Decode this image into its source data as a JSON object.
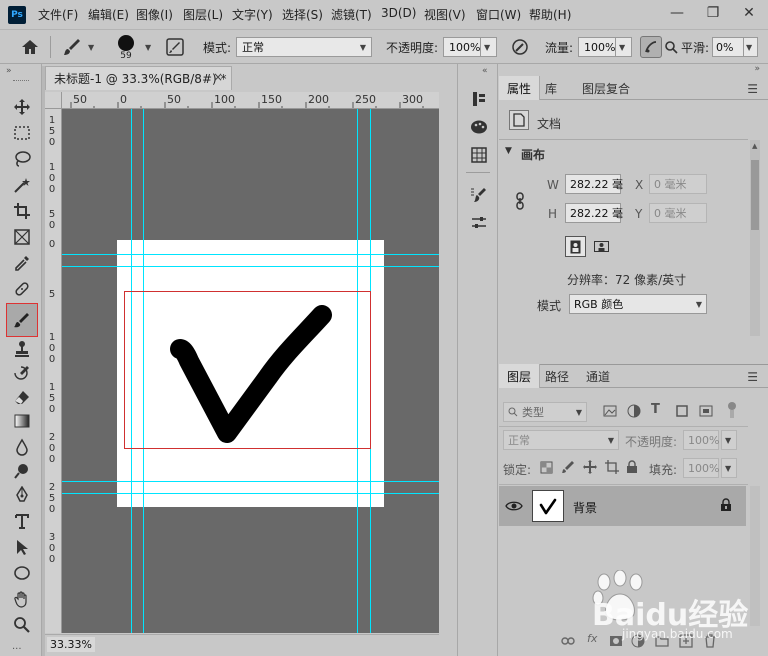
{
  "app": {
    "logo_text": "Ps"
  },
  "menu": [
    "文件(F)",
    "编辑(E)",
    "图像(I)",
    "图层(L)",
    "文字(Y)",
    "选择(S)",
    "滤镜(T)",
    "3D(D)",
    "视图(V)",
    "窗口(W)",
    "帮助(H)"
  ],
  "window_controls": {
    "minimize": "—",
    "maximize": "❐",
    "close": "✕"
  },
  "options_bar": {
    "brush_size": "59",
    "mode_label": "模式:",
    "mode_value": "正常",
    "opacity_label": "不透明度:",
    "opacity_value": "100%",
    "flow_label": "流量:",
    "flow_value": "100%",
    "smooth_label": "平滑:",
    "smooth_value": "0%"
  },
  "document": {
    "tab_title": "未标题-1 @ 33.3%(RGB/8#) *",
    "tab_close": "×",
    "zoom": "33.33%",
    "ruler_top": [
      "50",
      "0",
      "50",
      "100",
      "150",
      "200",
      "250",
      "300"
    ],
    "ruler_left": [
      [
        "1",
        "5",
        "0"
      ],
      [
        "1",
        "0",
        "0"
      ],
      [
        "5",
        "0"
      ],
      [
        "0"
      ],
      [
        "5"
      ],
      [
        "1",
        "0",
        "0"
      ],
      [
        "1",
        "5",
        "0"
      ],
      [
        "2",
        "0",
        "0"
      ],
      [
        "2",
        "5",
        "0"
      ],
      [
        "3",
        "0",
        "0"
      ]
    ]
  },
  "properties_panel": {
    "tabs": [
      "属性",
      "库",
      "图层复合"
    ],
    "doc_label": "文档",
    "section": "画布",
    "w_label": "W",
    "w_value": "282.22 毫",
    "h_label": "H",
    "h_value": "282.22 毫",
    "x_label": "X",
    "x_value": "0 毫米",
    "y_label": "Y",
    "y_value": "0 毫米",
    "resolution": "分辨率：72 像素/英寸",
    "mode_label": "模式",
    "mode_value": "RGB 颜色"
  },
  "layers_panel": {
    "tabs": [
      "图层",
      "路径",
      "通道"
    ],
    "filter_kind": "类型",
    "blend_mode": "正常",
    "opacity_label": "不透明度:",
    "opacity_value": "100%",
    "lock_label": "锁定:",
    "fill_label": "填充:",
    "fill_value": "100%",
    "layer_name": "背景"
  },
  "watermark": {
    "text": "Baidu经验",
    "sub": "jingyan.baidu.com"
  },
  "colors": {
    "ui_bg": "#c8c8c8",
    "canvas_bg": "#696969",
    "guide": "#00e5ff",
    "selection_red": "#d03030",
    "stroke": "#000000"
  }
}
